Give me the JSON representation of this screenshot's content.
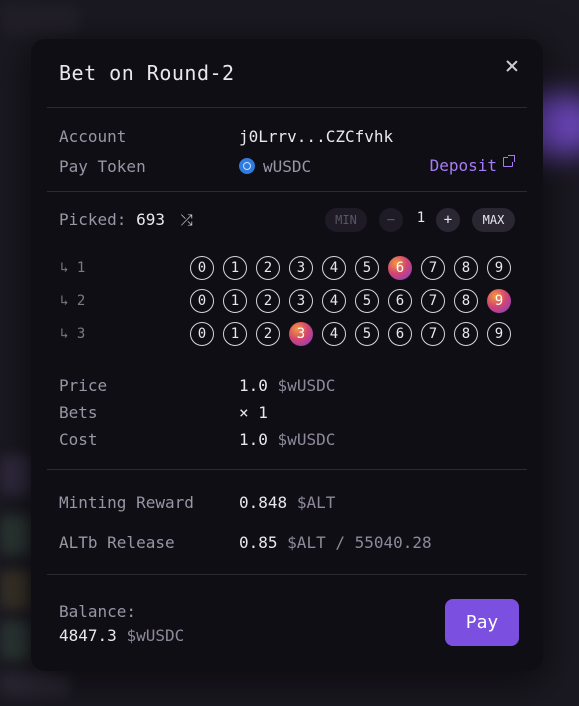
{
  "modal": {
    "title": "Bet on Round-2"
  },
  "account": {
    "label": "Account",
    "value": "j0Lrrv...CZCfvhk"
  },
  "pay_token": {
    "label": "Pay Token",
    "token_name": "wUSDC",
    "token_icon": "usdc-token-icon",
    "deposit_label": "Deposit"
  },
  "picker": {
    "picked_label": "Picked:",
    "picked_value": "693",
    "min_label": "MIN",
    "minus_label": "−",
    "quantity": "1",
    "plus_label": "+",
    "max_label": "MAX",
    "rows": [
      {
        "label": "↳ 1",
        "selected": 6
      },
      {
        "label": "↳ 2",
        "selected": 9
      },
      {
        "label": "↳ 3",
        "selected": 3
      }
    ],
    "digits": [
      "0",
      "1",
      "2",
      "3",
      "4",
      "5",
      "6",
      "7",
      "8",
      "9"
    ]
  },
  "summary": {
    "price_label": "Price",
    "price_value": "1.0",
    "price_unit": "$wUSDC",
    "bets_label": "Bets",
    "bets_value": "× 1",
    "cost_label": "Cost",
    "cost_value": "1.0",
    "cost_unit": "$wUSDC"
  },
  "rewards": {
    "minting_label": "Minting Reward",
    "minting_value": "0.848",
    "minting_unit": "$ALT",
    "release_label": "ALTb Release",
    "release_value": "0.85",
    "release_unit": "$ALT / 55040.28"
  },
  "footer": {
    "balance_label": "Balance:",
    "balance_value": "4847.3",
    "balance_unit": "$wUSDC",
    "pay_label": "Pay"
  },
  "colors": {
    "accent": "#7b4fe0",
    "link": "#a67bf5",
    "background": "#100e15"
  }
}
